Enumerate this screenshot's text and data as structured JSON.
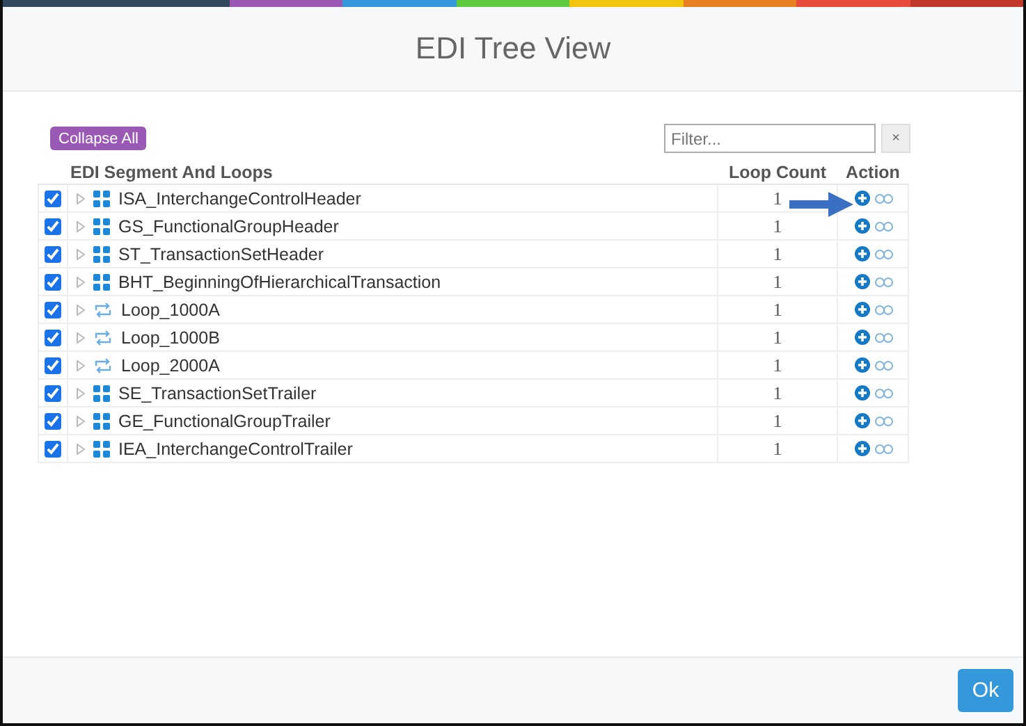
{
  "dialog": {
    "title": "EDI Tree View"
  },
  "toolbar": {
    "collapse_button": "Collapse All",
    "filter": {
      "placeholder": "Filter..."
    },
    "clear_button": "×"
  },
  "table": {
    "columns": [
      "EDI Segment And Loops",
      "Loop Count",
      "Action"
    ],
    "rows": [
      {
        "kind": "segment",
        "checked": true,
        "name": "ISA_InterchangeControlHeader",
        "loop_count": "1"
      },
      {
        "kind": "segment",
        "checked": true,
        "name": "GS_FunctionalGroupHeader",
        "loop_count": "1"
      },
      {
        "kind": "segment",
        "checked": true,
        "name": "ST_TransactionSetHeader",
        "loop_count": "1"
      },
      {
        "kind": "segment",
        "checked": true,
        "name": "BHT_BeginningOfHierarchicalTransaction",
        "loop_count": "1"
      },
      {
        "kind": "loop",
        "checked": true,
        "name": "Loop_1000A",
        "loop_count": "1"
      },
      {
        "kind": "loop",
        "checked": true,
        "name": "Loop_1000B",
        "loop_count": "1"
      },
      {
        "kind": "loop",
        "checked": true,
        "name": "Loop_2000A",
        "loop_count": "1"
      },
      {
        "kind": "segment",
        "checked": true,
        "name": "SE_TransactionSetTrailer",
        "loop_count": "1"
      },
      {
        "kind": "segment",
        "checked": true,
        "name": "GE_FunctionalGroupTrailer",
        "loop_count": "1"
      },
      {
        "kind": "segment",
        "checked": true,
        "name": "IEA_InterchangeControlTrailer",
        "loop_count": "1"
      }
    ]
  },
  "footer": {
    "ok_button": "Ok"
  }
}
